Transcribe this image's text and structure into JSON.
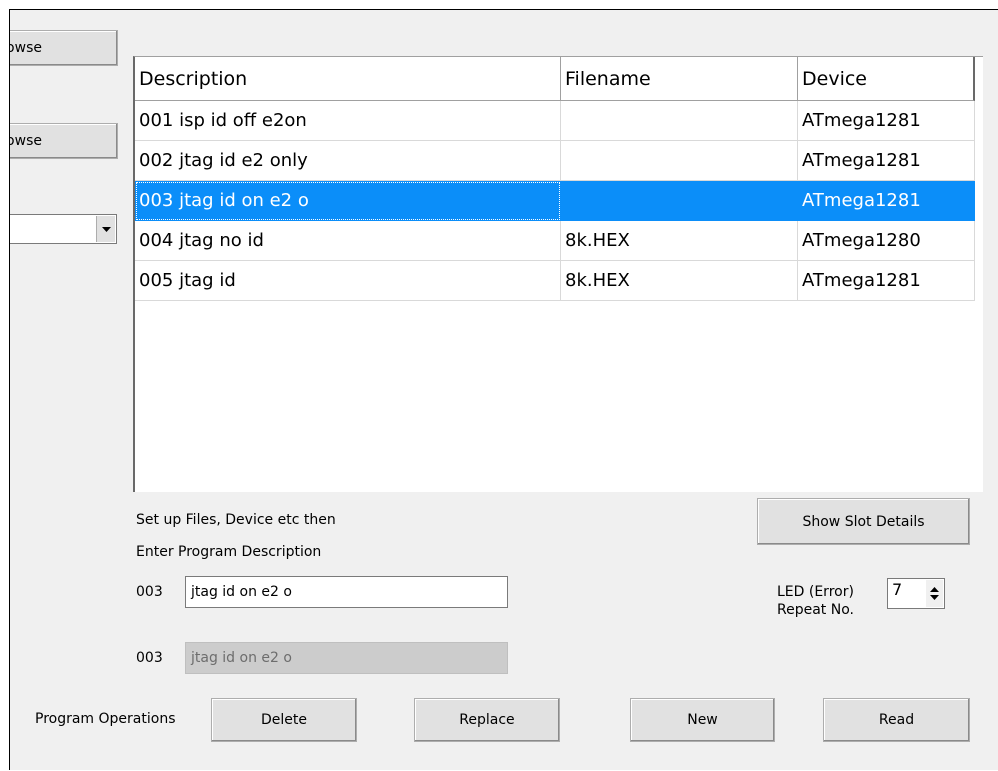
{
  "browse_buttons": [
    {
      "label": "Browse"
    },
    {
      "label": "Browse"
    }
  ],
  "device_combo": {
    "value": ""
  },
  "listview": {
    "headers": [
      "Description",
      "Filename",
      "Device"
    ],
    "rows": [
      {
        "description": "001 isp id off  e2on",
        "filename": "",
        "device": "ATmega1281",
        "selected": false
      },
      {
        "description": "002 jtag  id e2 only",
        "filename": "",
        "device": "ATmega1281",
        "selected": false
      },
      {
        "description": "003 jtag id on  e2 o",
        "filename": "",
        "device": "ATmega1281",
        "selected": true
      },
      {
        "description": "004 jtag no id",
        "filename": "8k.HEX",
        "device": "ATmega1280",
        "selected": false
      },
      {
        "description": "005 jtag id",
        "filename": "8k.HEX",
        "device": "ATmega1281",
        "selected": false
      }
    ]
  },
  "instructions": {
    "line1": "Set up Files, Device etc then",
    "line2": "Enter Program Description"
  },
  "description_entry": {
    "slot": "003",
    "value": "jtag id on  e2 o"
  },
  "description_readonly": {
    "slot": "003",
    "value": "jtag id on  e2 o"
  },
  "show_slot_details": {
    "label": "Show Slot Details"
  },
  "led_repeat": {
    "label_line1": "LED (Error)",
    "label_line2": "Repeat No.",
    "value": "7"
  },
  "program_operations": {
    "label": "Program Operations",
    "delete": "Delete",
    "replace": "Replace",
    "new": "New",
    "read": "Read"
  }
}
